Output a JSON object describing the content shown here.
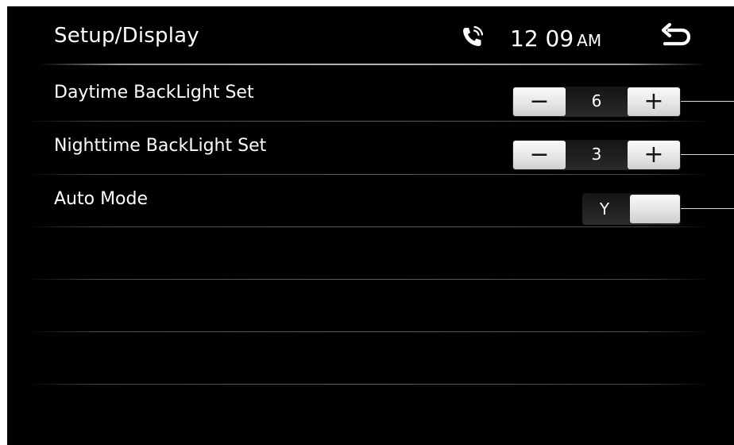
{
  "header": {
    "title": "Setup/Display",
    "time": "12 09",
    "ampm": "AM",
    "phone_icon": "phone-icon",
    "back_icon": "back-arrow-icon"
  },
  "settings": [
    {
      "label": "Daytime BackLight Set",
      "type": "stepper",
      "value": "6",
      "minus": "−",
      "plus": "+"
    },
    {
      "label": "Nighttime BackLight Set",
      "type": "stepper",
      "value": "3",
      "minus": "−",
      "plus": "+"
    },
    {
      "label": "Auto Mode",
      "type": "toggle",
      "value": "Y"
    }
  ],
  "colors": {
    "background": "#000000",
    "text": "#ffffff",
    "button": "#e6e6e6"
  }
}
